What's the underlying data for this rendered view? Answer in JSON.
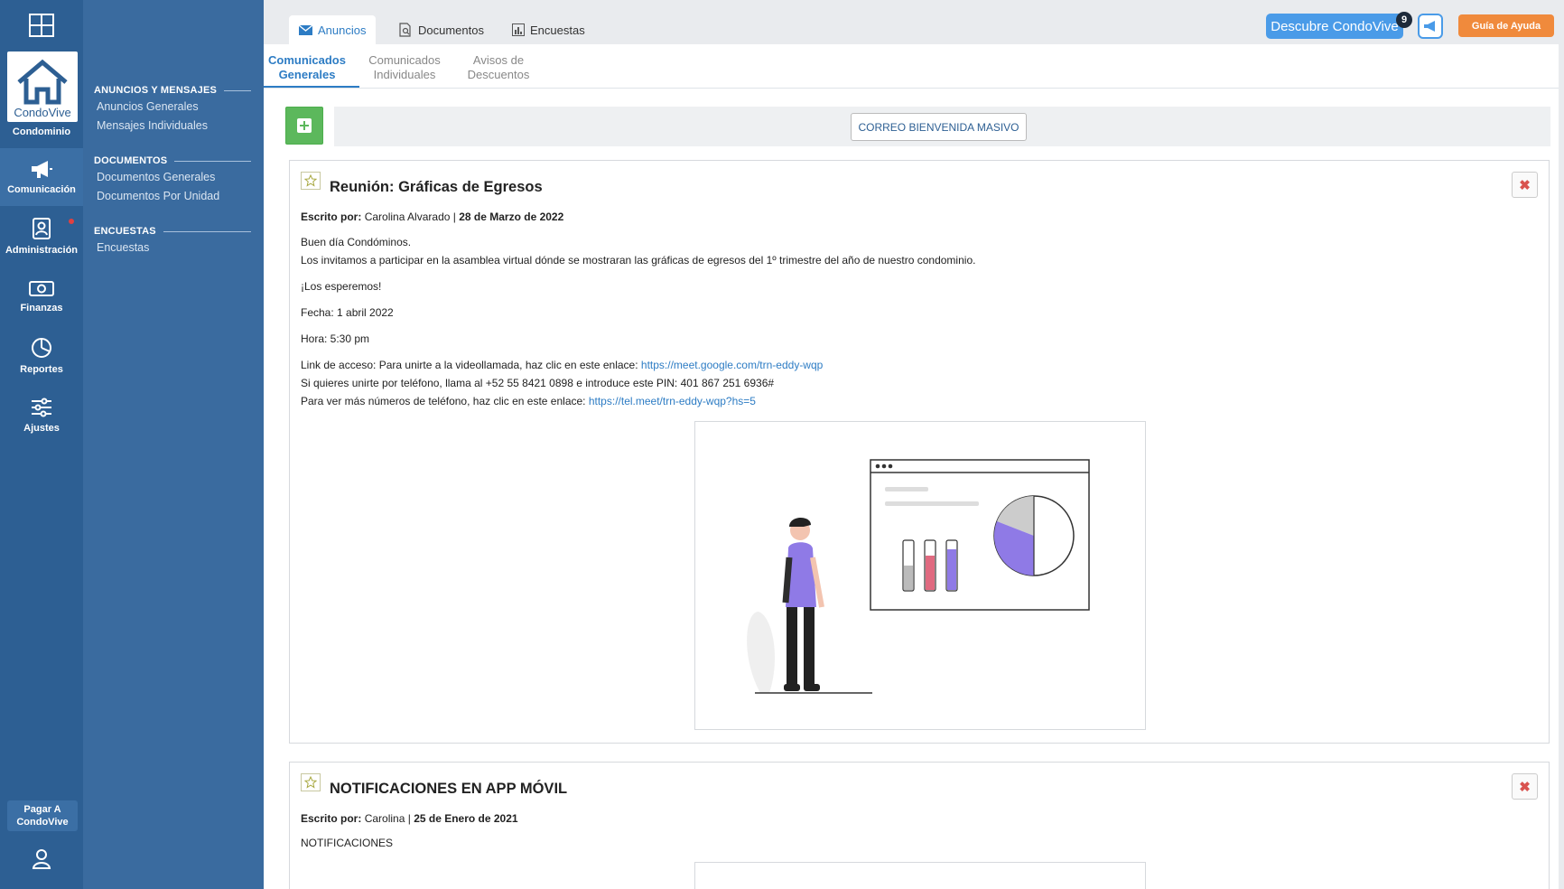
{
  "rail": {
    "brand": "CondoVive",
    "brand_sub": "Condominio",
    "items": [
      {
        "label": "Comunicación",
        "icon": "megaphone-icon"
      },
      {
        "label": "Administración",
        "icon": "admin-icon"
      },
      {
        "label": "Finanzas",
        "icon": "money-icon"
      },
      {
        "label": "Reportes",
        "icon": "chart-icon"
      },
      {
        "label": "Ajustes",
        "icon": "sliders-icon"
      }
    ],
    "pay_label_1": "Pagar A",
    "pay_label_2": "CondoVive"
  },
  "subnav": {
    "sections": [
      {
        "title": "ANUNCIOS Y MENSAJES",
        "links": [
          "Anuncios Generales",
          "Mensajes Individuales"
        ]
      },
      {
        "title": "DOCUMENTOS",
        "links": [
          "Documentos Generales",
          "Documentos Por Unidad"
        ]
      },
      {
        "title": "ENCUESTAS",
        "links": [
          "Encuestas"
        ]
      }
    ]
  },
  "top": {
    "tabs": [
      "Anuncios",
      "Documentos",
      "Encuestas"
    ],
    "discover_label": "Descubre CondoVive",
    "discover_badge": "9",
    "help_label": "Guía de Ayuda"
  },
  "subtabs": [
    {
      "line1": "Comunicados",
      "line2": "Generales"
    },
    {
      "line1": "Comunicados",
      "line2": "Individuales"
    },
    {
      "line1": "Avisos de",
      "line2": "Descuentos"
    }
  ],
  "actions": {
    "mail_label": "CORREO BIENVENIDA MASIVO"
  },
  "posts": [
    {
      "title": "Reunión: Gráficas de Egresos",
      "author_label": "Escrito por:",
      "author": "Carolina Alvarado",
      "date": "28 de Marzo de 2022",
      "greeting": "Buen día Condóminos.",
      "invite": "Los invitamos a participar en la asamblea virtual dónde se mostraran las gráficas de egresos del 1º trimestre del año de nuestro condominio.",
      "see_you": "¡Los esperemos!",
      "fecha": "Fecha: 1 abril 2022",
      "hora": "Hora: 5:30 pm",
      "link_text": "Link de acceso: Para unirte a la videollamada, haz clic en este enlace: ",
      "link_url": "https://meet.google.com/trn-eddy-wqp",
      "phone_text": "Si quieres unirte por teléfono, llama al +52 55 8421 0898 e introduce este PIN: 401 867 251 6936#",
      "more_text": "Para ver más números de teléfono, haz clic en este enlace: ",
      "more_url": "https://tel.meet/trn-eddy-wqp?hs=5"
    },
    {
      "title": "NOTIFICACIONES EN APP MÓVIL",
      "author_label": "Escrito por:",
      "author": "Carolina",
      "date": "25 de Enero de 2021",
      "body": "NOTIFICACIONES"
    }
  ],
  "colors": {
    "rail": "#2d5f93",
    "subnav": "#3a6b9f",
    "accent": "#2d7cc4",
    "add": "#5cb85c",
    "help": "#f08a3c",
    "chart_purple": "#8f7ae6",
    "chart_red": "#e06a80"
  }
}
